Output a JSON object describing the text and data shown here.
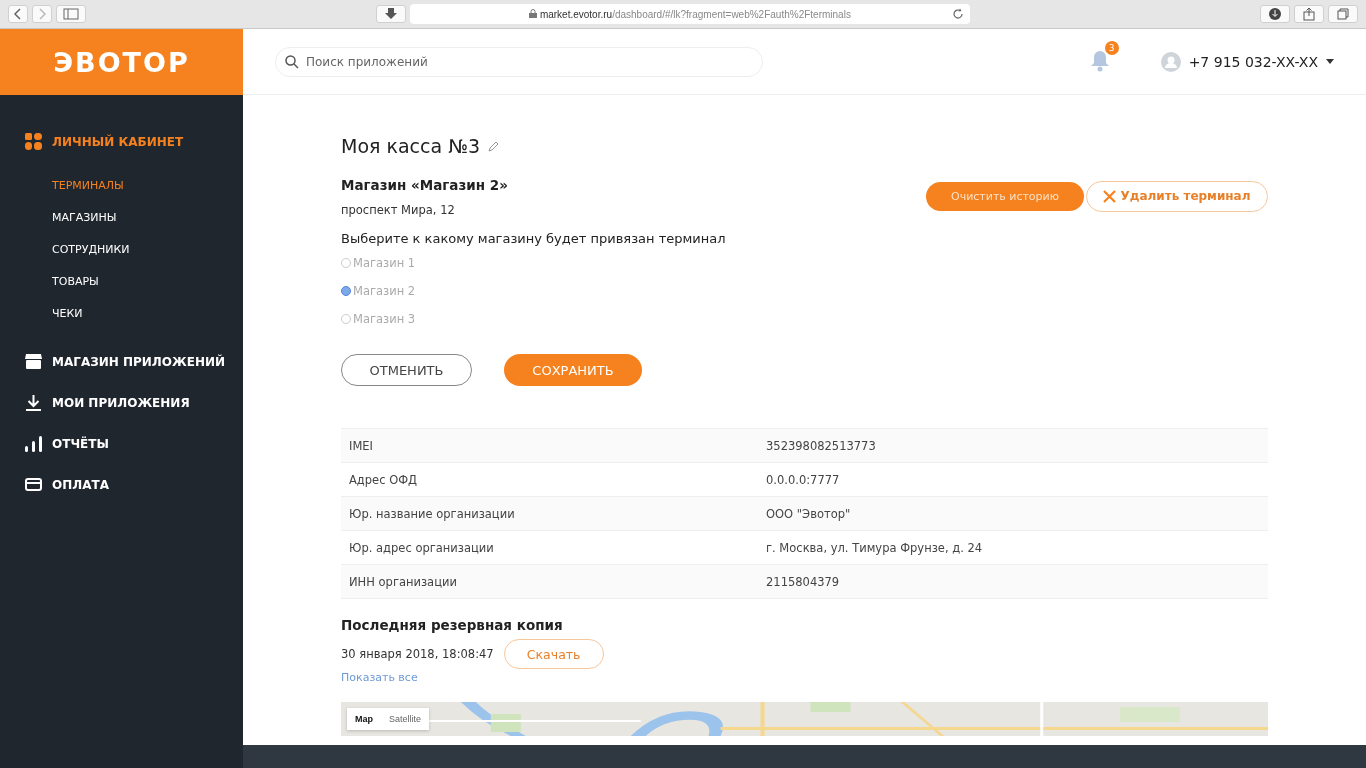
{
  "browser": {
    "url_host": "market.evotor.ru",
    "url_path": "/dashboard/#/lk?fragment=web%2Fauth%2Fterminals"
  },
  "logo": "ЭВОТОР",
  "search": {
    "placeholder": "Поиск приложений"
  },
  "notifications": {
    "count": "3"
  },
  "user": {
    "phone": "+7 915 032-XX-XX"
  },
  "sidebar": {
    "sections": [
      {
        "label": "ЛИЧНЫЙ КАБИНЕТ",
        "kind": "grid",
        "selected": true,
        "children": [
          {
            "label": "ТЕРМИНАЛЫ",
            "selected": true
          },
          {
            "label": "МАГАЗИНЫ",
            "selected": false
          },
          {
            "label": "СОТРУДНИКИ",
            "selected": false
          },
          {
            "label": "ТОВАРЫ",
            "selected": false
          },
          {
            "label": "ЧЕКИ",
            "selected": false
          }
        ]
      },
      {
        "label": "МАГАЗИН ПРИЛОЖЕНИЙ",
        "kind": "store",
        "selected": false
      },
      {
        "label": "МОИ ПРИЛОЖЕНИЯ",
        "kind": "download",
        "selected": false
      },
      {
        "label": "ОТЧЁТЫ",
        "kind": "bars",
        "selected": false
      },
      {
        "label": "ОПЛАТА",
        "kind": "card",
        "selected": false
      }
    ]
  },
  "terminal": {
    "title": "Моя касса №3",
    "store_name": "Магазин «Магазин 2»",
    "store_address": "проспект Мира, 12",
    "clear_history": "Очистить историю",
    "delete_terminal": "Удалить терминал",
    "choose_label": "Выберите к какому магазину будет привязан терминал",
    "stores": [
      {
        "label": "Магазин 1",
        "selected": false
      },
      {
        "label": "Магазин 2",
        "selected": true
      },
      {
        "label": "Магазин 3",
        "selected": false
      }
    ],
    "cancel": "ОТМЕНИТЬ",
    "save": "СОХРАНИТЬ"
  },
  "details": [
    {
      "name": "IMEI",
      "value": "352398082513773"
    },
    {
      "name": "Адрес ОФД",
      "value": "0.0.0.0:7777"
    },
    {
      "name": "Юр. название организации",
      "value": "ООО \"Эвотор\""
    },
    {
      "name": "Юр. адрес организации",
      "value": "г. Москва, ул. Тимура Фрунзе, д. 24"
    },
    {
      "name": "ИНН организации",
      "value": "2115804379"
    }
  ],
  "backup": {
    "title": "Последняя резервная копия",
    "date": "30 января 2018, 18:08:47",
    "download": "Скачать",
    "show_all": "Показать все"
  },
  "map": {
    "kind": "picture",
    "types": [
      {
        "label": "Map",
        "selected": true
      },
      {
        "label": "Satellite",
        "selected": false
      }
    ]
  }
}
